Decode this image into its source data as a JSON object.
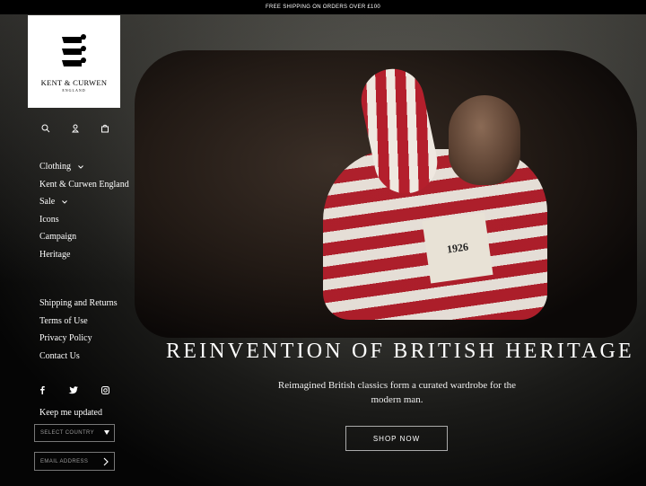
{
  "announcement": "FREE SHIPPING ON ORDERS OVER £100",
  "brand": {
    "name": "KENT & CURWEN",
    "sub": "ENGLAND"
  },
  "header_icons": [
    "search-icon",
    "account-icon",
    "bag-icon"
  ],
  "nav": {
    "primary": [
      {
        "label": "Clothing",
        "has_dropdown": true
      },
      {
        "label": "Kent & Curwen England",
        "has_dropdown": false
      },
      {
        "label": "Sale",
        "has_dropdown": true
      },
      {
        "label": "Icons",
        "has_dropdown": false
      },
      {
        "label": "Campaign",
        "has_dropdown": false
      },
      {
        "label": "Heritage",
        "has_dropdown": false
      }
    ],
    "secondary": [
      {
        "label": "Shipping and Returns"
      },
      {
        "label": "Terms of Use"
      },
      {
        "label": "Privacy Policy"
      },
      {
        "label": "Contact Us"
      }
    ]
  },
  "social": [
    "facebook-icon",
    "twitter-icon",
    "instagram-icon"
  ],
  "newsletter": {
    "title": "Keep me updated",
    "country_placeholder": "SELECT COUNTRY",
    "email_placeholder": "EMAIL ADDRESS"
  },
  "hero": {
    "patch_text": "1926",
    "headline": "REINVENTION OF BRITISH HERITAGE",
    "subtext": "Reimagined British classics form a curated wardrobe for the modern man.",
    "cta": "SHOP NOW"
  }
}
